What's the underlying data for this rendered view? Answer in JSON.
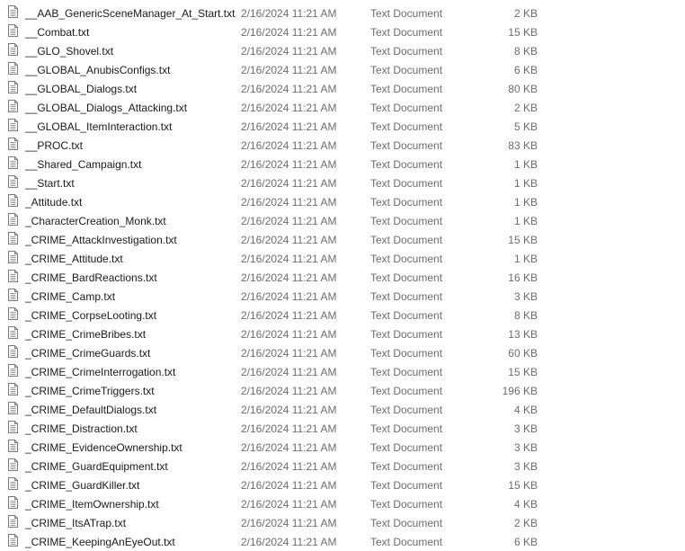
{
  "file_icon": "text-document-icon",
  "files": [
    {
      "name": "__AAB_GenericSceneManager_At_Start.txt",
      "date": "2/16/2024 11:21 AM",
      "type": "Text Document",
      "size": "2 KB"
    },
    {
      "name": "__Combat.txt",
      "date": "2/16/2024 11:21 AM",
      "type": "Text Document",
      "size": "15 KB"
    },
    {
      "name": "__GLO_Shovel.txt",
      "date": "2/16/2024 11:21 AM",
      "type": "Text Document",
      "size": "8 KB"
    },
    {
      "name": "__GLOBAL_AnubisConfigs.txt",
      "date": "2/16/2024 11:21 AM",
      "type": "Text Document",
      "size": "6 KB"
    },
    {
      "name": "__GLOBAL_Dialogs.txt",
      "date": "2/16/2024 11:21 AM",
      "type": "Text Document",
      "size": "80 KB"
    },
    {
      "name": "__GLOBAL_Dialogs_Attacking.txt",
      "date": "2/16/2024 11:21 AM",
      "type": "Text Document",
      "size": "2 KB"
    },
    {
      "name": "__GLOBAL_ItemInteraction.txt",
      "date": "2/16/2024 11:21 AM",
      "type": "Text Document",
      "size": "5 KB"
    },
    {
      "name": "__PROC.txt",
      "date": "2/16/2024 11:21 AM",
      "type": "Text Document",
      "size": "83 KB"
    },
    {
      "name": "__Shared_Campaign.txt",
      "date": "2/16/2024 11:21 AM",
      "type": "Text Document",
      "size": "1 KB"
    },
    {
      "name": "__Start.txt",
      "date": "2/16/2024 11:21 AM",
      "type": "Text Document",
      "size": "1 KB"
    },
    {
      "name": "_Attitude.txt",
      "date": "2/16/2024 11:21 AM",
      "type": "Text Document",
      "size": "1 KB"
    },
    {
      "name": "_CharacterCreation_Monk.txt",
      "date": "2/16/2024 11:21 AM",
      "type": "Text Document",
      "size": "1 KB"
    },
    {
      "name": "_CRIME_AttackInvestigation.txt",
      "date": "2/16/2024 11:21 AM",
      "type": "Text Document",
      "size": "15 KB"
    },
    {
      "name": "_CRIME_Attitude.txt",
      "date": "2/16/2024 11:21 AM",
      "type": "Text Document",
      "size": "1 KB"
    },
    {
      "name": "_CRIME_BardReactions.txt",
      "date": "2/16/2024 11:21 AM",
      "type": "Text Document",
      "size": "16 KB"
    },
    {
      "name": "_CRIME_Camp.txt",
      "date": "2/16/2024 11:21 AM",
      "type": "Text Document",
      "size": "3 KB"
    },
    {
      "name": "_CRIME_CorpseLooting.txt",
      "date": "2/16/2024 11:21 AM",
      "type": "Text Document",
      "size": "8 KB"
    },
    {
      "name": "_CRIME_CrimeBribes.txt",
      "date": "2/16/2024 11:21 AM",
      "type": "Text Document",
      "size": "13 KB"
    },
    {
      "name": "_CRIME_CrimeGuards.txt",
      "date": "2/16/2024 11:21 AM",
      "type": "Text Document",
      "size": "60 KB"
    },
    {
      "name": "_CRIME_CrimeInterrogation.txt",
      "date": "2/16/2024 11:21 AM",
      "type": "Text Document",
      "size": "15 KB"
    },
    {
      "name": "_CRIME_CrimeTriggers.txt",
      "date": "2/16/2024 11:21 AM",
      "type": "Text Document",
      "size": "196 KB"
    },
    {
      "name": "_CRIME_DefaultDialogs.txt",
      "date": "2/16/2024 11:21 AM",
      "type": "Text Document",
      "size": "4 KB"
    },
    {
      "name": "_CRIME_Distraction.txt",
      "date": "2/16/2024 11:21 AM",
      "type": "Text Document",
      "size": "3 KB"
    },
    {
      "name": "_CRIME_EvidenceOwnership.txt",
      "date": "2/16/2024 11:21 AM",
      "type": "Text Document",
      "size": "3 KB"
    },
    {
      "name": "_CRIME_GuardEquipment.txt",
      "date": "2/16/2024 11:21 AM",
      "type": "Text Document",
      "size": "3 KB"
    },
    {
      "name": "_CRIME_GuardKiller.txt",
      "date": "2/16/2024 11:21 AM",
      "type": "Text Document",
      "size": "15 KB"
    },
    {
      "name": "_CRIME_ItemOwnership.txt",
      "date": "2/16/2024 11:21 AM",
      "type": "Text Document",
      "size": "4 KB"
    },
    {
      "name": "_CRIME_ItsATrap.txt",
      "date": "2/16/2024 11:21 AM",
      "type": "Text Document",
      "size": "2 KB"
    },
    {
      "name": "_CRIME_KeepingAnEyeOut.txt",
      "date": "2/16/2024 11:21 AM",
      "type": "Text Document",
      "size": "6 KB"
    }
  ]
}
